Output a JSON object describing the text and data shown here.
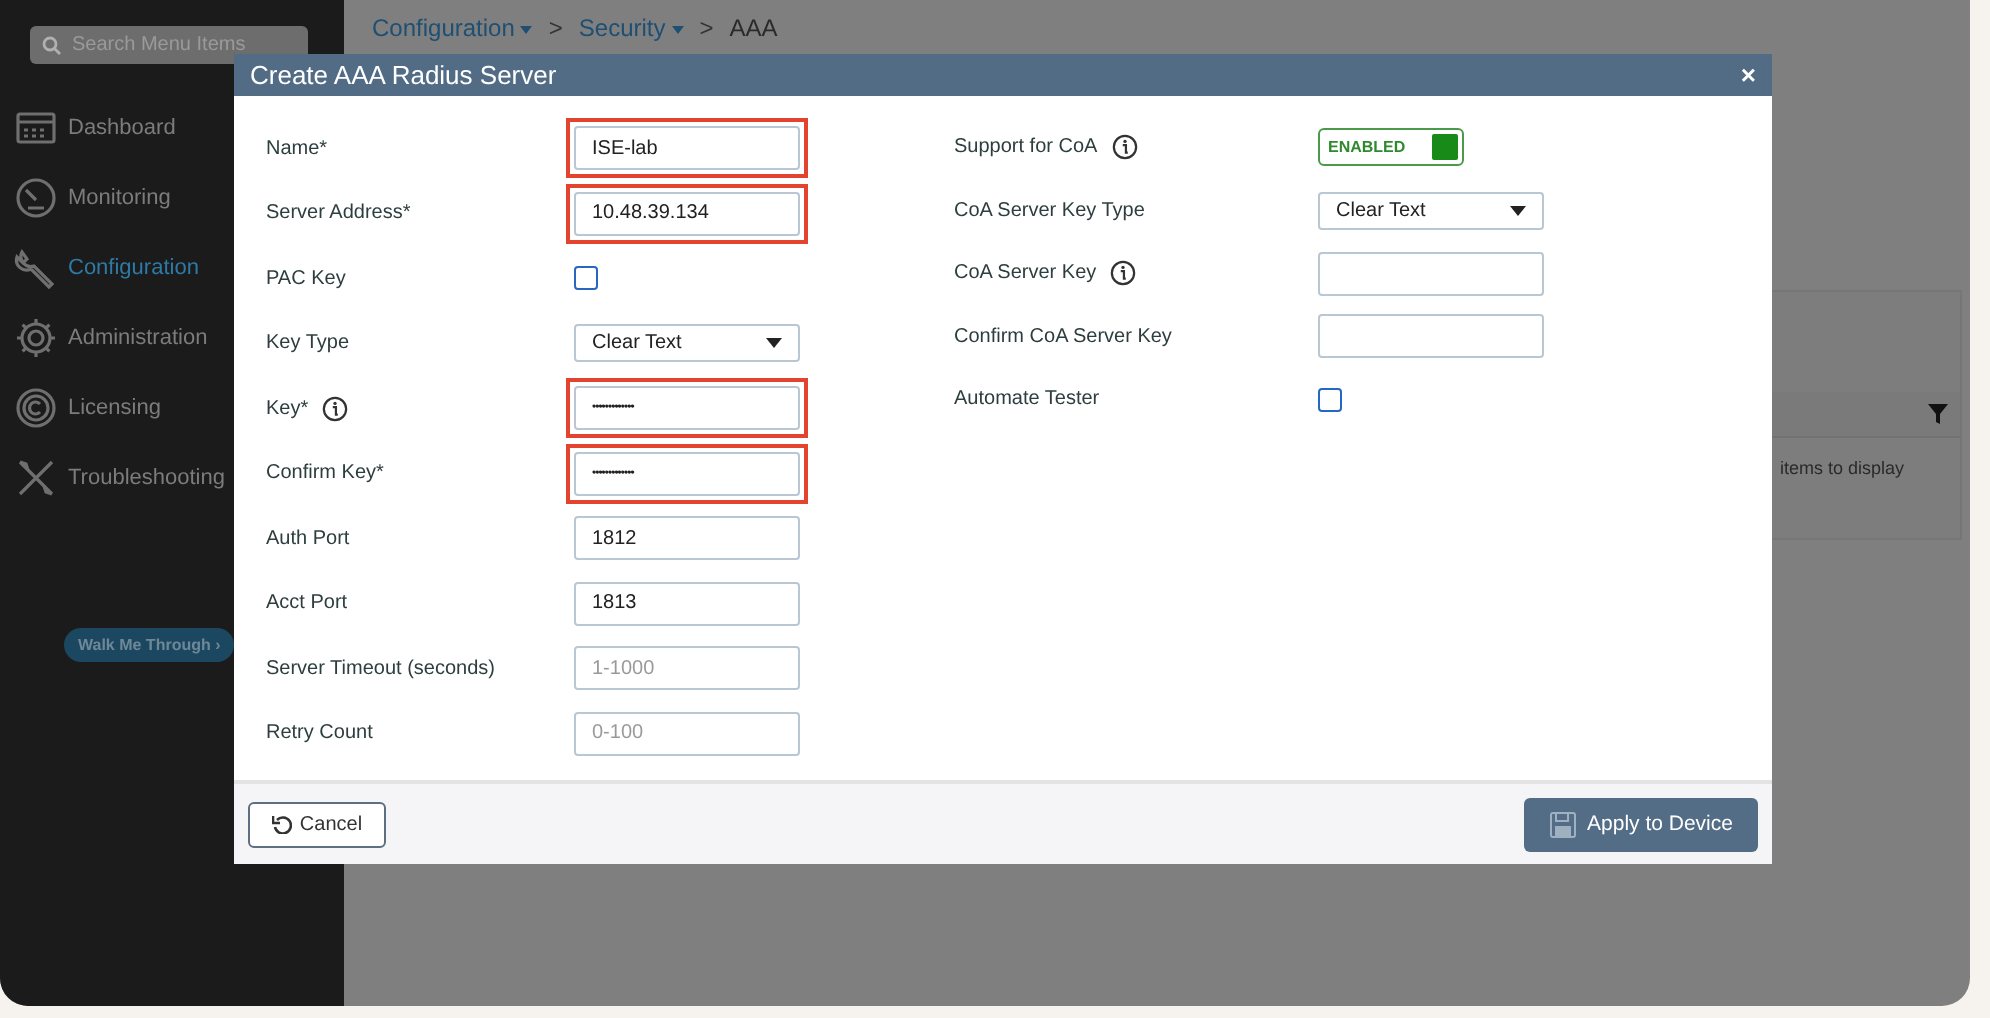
{
  "sidebar": {
    "search": {
      "placeholder": "Search Menu Items"
    },
    "items": [
      {
        "label": "Dashboard",
        "selected": false
      },
      {
        "label": "Monitoring",
        "selected": false
      },
      {
        "label": "Configuration",
        "selected": true
      },
      {
        "label": "Administration",
        "selected": false
      },
      {
        "label": "Licensing",
        "selected": false
      },
      {
        "label": "Troubleshooting",
        "selected": false
      }
    ],
    "walk_button": "Walk Me Through ›"
  },
  "breadcrumb": {
    "separator": ">",
    "items": [
      {
        "label": "Configuration",
        "dropdown": true
      },
      {
        "label": "Security",
        "dropdown": true
      },
      {
        "label": "AAA",
        "dropdown": false
      }
    ]
  },
  "background_table": {
    "empty_text": "items to display"
  },
  "dialog": {
    "title": "Create AAA Radius Server",
    "close": "×",
    "left_fields": [
      {
        "label": "Name*",
        "kind": "text",
        "value": "ISE-lab",
        "highlighted": true,
        "info": false
      },
      {
        "label": "Server Address*",
        "kind": "text",
        "value": "10.48.39.134",
        "highlighted": true,
        "info": false
      },
      {
        "label": "PAC Key",
        "kind": "checkbox",
        "checked": false,
        "highlighted": false,
        "info": false
      },
      {
        "label": "Key Type",
        "kind": "select",
        "value": "Clear Text",
        "highlighted": false,
        "info": false
      },
      {
        "label": "Key*",
        "kind": "text",
        "value": "•••••••••••••",
        "highlighted": true,
        "info": true
      },
      {
        "label": "Confirm Key*",
        "kind": "text",
        "value": "•••••••••••••",
        "highlighted": true,
        "info": false
      },
      {
        "label": "Auth Port",
        "kind": "text",
        "value": "1812",
        "highlighted": false,
        "info": false
      },
      {
        "label": "Acct Port",
        "kind": "text",
        "value": "1813",
        "highlighted": false,
        "info": false
      },
      {
        "label": "Server Timeout (seconds)",
        "kind": "text",
        "placeholder": "1-1000",
        "highlighted": false,
        "info": false
      },
      {
        "label": "Retry Count",
        "kind": "text",
        "placeholder": "0-100",
        "highlighted": false,
        "info": false
      }
    ],
    "right_fields": [
      {
        "label": "Support for CoA",
        "kind": "toggle",
        "on": true,
        "state_text": "ENABLED",
        "highlighted": false,
        "info": true
      },
      {
        "label": "CoA Server Key Type",
        "kind": "select",
        "value": "Clear Text",
        "highlighted": false,
        "info": false
      },
      {
        "label": "CoA Server Key",
        "kind": "text",
        "highlighted": false,
        "info": true
      },
      {
        "label": "Confirm CoA Server Key",
        "kind": "text",
        "highlighted": false,
        "info": false
      },
      {
        "label": "Automate Tester",
        "kind": "checkbox",
        "checked": false,
        "highlighted": false,
        "info": false
      }
    ],
    "cancel_button": "Cancel",
    "apply_button": "Apply to Device"
  }
}
